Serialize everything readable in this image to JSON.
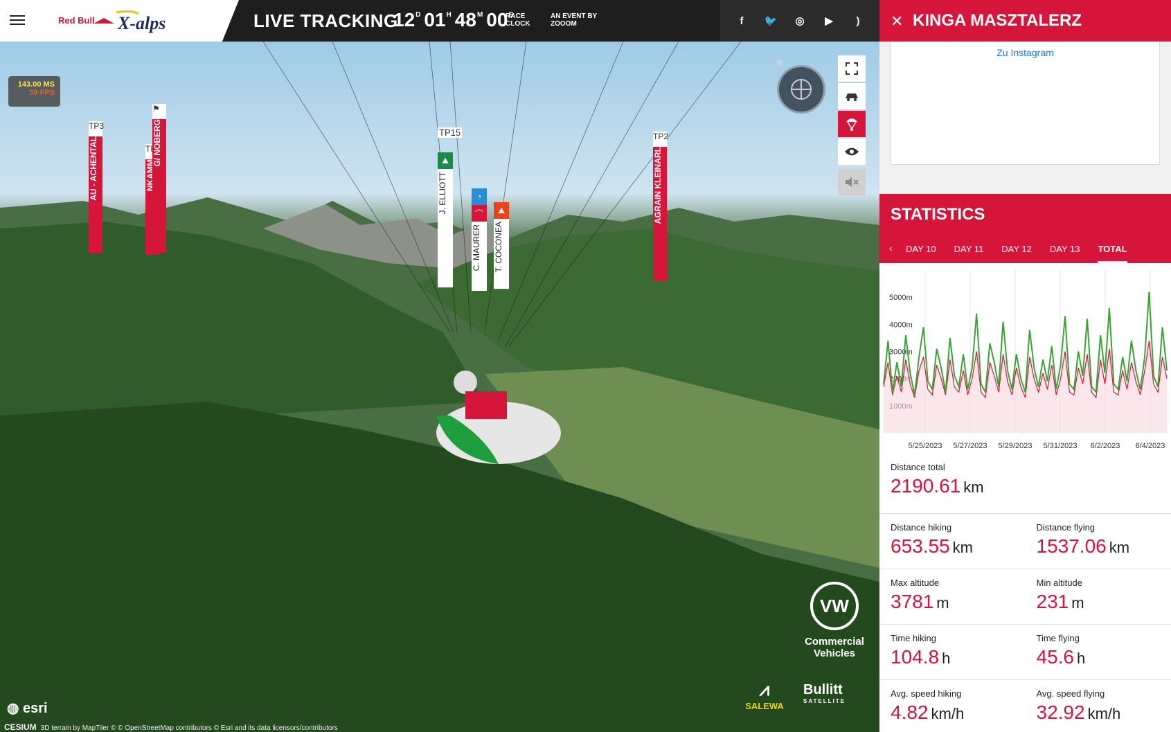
{
  "header": {
    "brand": "Red Bull",
    "brand_logo": "X-alps",
    "title": "LIVE TRACKING",
    "clock": [
      {
        "v": "12",
        "u": "D"
      },
      {
        "v": "01",
        "u": "H"
      },
      {
        "v": "48",
        "u": "M"
      },
      {
        "v": "00",
        "u": "S"
      }
    ],
    "clock_label_1": "RACE",
    "clock_label_2": "CLOCK",
    "event_by_1": "AN EVENT BY",
    "event_by_2": "ZOOOM",
    "social": [
      {
        "name": "facebook-icon",
        "glyph": "f"
      },
      {
        "name": "twitter-icon",
        "glyph": "🐦"
      },
      {
        "name": "instagram-icon",
        "glyph": "◎"
      },
      {
        "name": "youtube-icon",
        "glyph": "▶"
      },
      {
        "name": "rss-icon",
        "glyph": ")"
      }
    ]
  },
  "map": {
    "perf_ms": "143.00 MS",
    "perf_fps": "59 FPS",
    "turnpoints": [
      {
        "id": "TP3",
        "label": "AU - ACHENTAL"
      },
      {
        "id": "TP1",
        "label": "NKAMM"
      },
      {
        "id": "",
        "label": "G/ NOBERG"
      },
      {
        "id": "TP2",
        "label": "AGRAIN KLEINARL"
      }
    ],
    "tp_top_label": "TP15",
    "pilots": [
      {
        "label": "J. ELLIOTT",
        "color": "#1b8a4b"
      },
      {
        "label": "C. MAURER",
        "color": "#d6153b"
      },
      {
        "label": "T. COCONEA",
        "color": "#e8431b"
      }
    ],
    "compass_n": "N",
    "sponsor_vw_1": "Commercial",
    "sponsor_vw_2": "Vehicles",
    "sponsor_salewa": "SALEWA",
    "sponsor_bullitt": "Bullitt",
    "sponsor_bullitt_sub": "SATELLITE",
    "esri": "esri",
    "cesium": "CESIUM",
    "attribution": "3D terrain by MapTiler © © OpenStreetMap contributors © Esri and its data licensors/contributors"
  },
  "panel": {
    "athlete_name": "KINGA MASZTALERZ",
    "insta_link": "Zu Instagram",
    "stats_title": "STATISTICS",
    "tabs": [
      "DAY 10",
      "DAY 11",
      "DAY 12",
      "DAY 13",
      "TOTAL"
    ],
    "active_tab": "TOTAL",
    "stats": [
      [
        {
          "label": "Distance total",
          "value": "2190.61",
          "unit": "km"
        }
      ],
      [
        {
          "label": "Distance hiking",
          "value": "653.55",
          "unit": "km"
        },
        {
          "label": "Distance flying",
          "value": "1537.06",
          "unit": "km"
        }
      ],
      [
        {
          "label": "Max altitude",
          "value": "3781",
          "unit": "m"
        },
        {
          "label": "Min altitude",
          "value": "231",
          "unit": "m"
        }
      ],
      [
        {
          "label": "Time hiking",
          "value": "104.8",
          "unit": "h"
        },
        {
          "label": "Time flying",
          "value": "45.6",
          "unit": "h"
        }
      ],
      [
        {
          "label": "Avg. speed hiking",
          "value": "4.82",
          "unit": "km/h"
        },
        {
          "label": "Avg. speed flying",
          "value": "32.92",
          "unit": "km/h"
        }
      ]
    ]
  },
  "colors": {
    "accent": "#d6153b",
    "flying_series": "#3aa336",
    "ground_series": "#d6153b"
  },
  "chart_data": {
    "type": "line",
    "title": "",
    "xlabel": "",
    "ylabel": "",
    "x_ticks": [
      "5/25/2023",
      "5/27/2023",
      "5/29/2023",
      "5/31/2023",
      "6/2/2023",
      "6/4/2023"
    ],
    "y_ticks": [
      "1000m",
      "2000m",
      "3000m",
      "4000m",
      "5000m"
    ],
    "ylim": [
      0,
      6000
    ],
    "grid": true,
    "series": [
      {
        "values": [
          1800,
          3400,
          1500,
          2600,
          1700,
          3600,
          2200,
          1400,
          2800,
          3900,
          1900,
          1600,
          3100,
          2400,
          1500,
          3500,
          2100,
          1700,
          2900,
          1600,
          2400,
          4400,
          1800,
          1500,
          3300,
          2600,
          1700,
          4100,
          2300,
          1600,
          2900,
          2000,
          1500,
          3800,
          2400,
          1700,
          2700,
          1900,
          3200,
          1600,
          2500,
          4300,
          1800,
          1600,
          3000,
          2100,
          4200,
          1700,
          1500,
          3600,
          2200,
          4600,
          1800,
          1600,
          2800,
          1900,
          3400,
          2300,
          1600,
          2800,
          5200,
          2100,
          1700,
          3900,
          2300
        ]
      },
      {
        "values": [
          1700,
          2600,
          1400,
          2100,
          1500,
          2700,
          1800,
          1300,
          2300,
          2800,
          1600,
          1400,
          2500,
          2000,
          1400,
          2700,
          1700,
          1500,
          2300,
          1400,
          2000,
          3000,
          1500,
          1300,
          2600,
          2100,
          1500,
          2900,
          1900,
          1400,
          2400,
          1700,
          1300,
          2800,
          2000,
          1500,
          2200,
          1600,
          2500,
          1400,
          2000,
          3000,
          1500,
          1400,
          2400,
          1800,
          2900,
          1500,
          1300,
          2700,
          1800,
          3100,
          1500,
          1400,
          2300,
          1600,
          2600,
          1900,
          1400,
          2300,
          3400,
          1800,
          1500,
          2800,
          2000
        ]
      }
    ]
  }
}
